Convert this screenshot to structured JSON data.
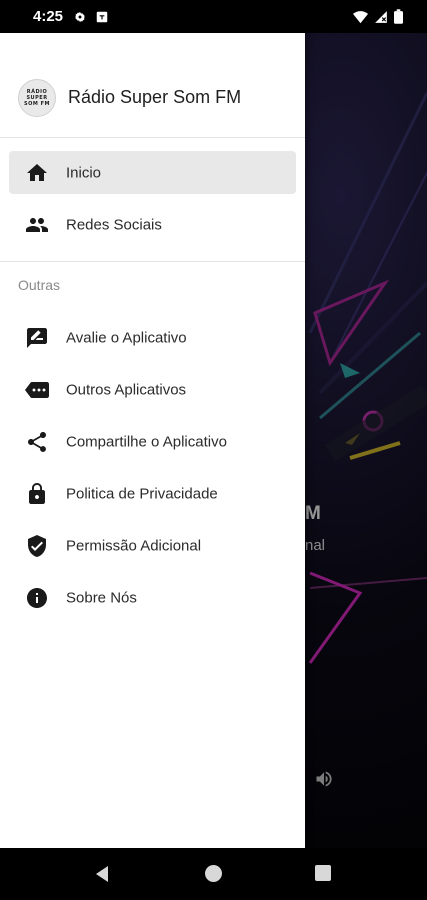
{
  "status_bar": {
    "time": "4:25"
  },
  "background": {
    "text_line_1": "M",
    "text_line_2": "nal"
  },
  "drawer": {
    "logo_text": [
      "RÁDIO",
      "SUPER",
      "SOM FM"
    ],
    "title": "Rádio Super Som FM",
    "primary_items": [
      {
        "label": "Inicio",
        "icon": "home-icon",
        "active": true
      },
      {
        "label": "Redes Sociais",
        "icon": "people-icon",
        "active": false
      }
    ],
    "section_title": "Outras",
    "secondary_items": [
      {
        "label": "Avalie o Aplicativo",
        "icon": "rate-review-icon"
      },
      {
        "label": "Outros Aplicativos",
        "icon": "more-apps-icon"
      },
      {
        "label": "Compartilhe o Aplicativo",
        "icon": "share-icon"
      },
      {
        "label": "Politica de Privacidade",
        "icon": "lock-icon"
      },
      {
        "label": "Permissão Adicional",
        "icon": "shield-check-icon"
      },
      {
        "label": "Sobre Nós",
        "icon": "info-icon"
      }
    ]
  },
  "colors": {
    "drawer_bg": "#ffffff",
    "active_item_bg": "#e8e8e8",
    "icon_color": "#1a1a1a",
    "text_color": "#2b2b2b",
    "section_label_color": "#8a8a8a"
  }
}
